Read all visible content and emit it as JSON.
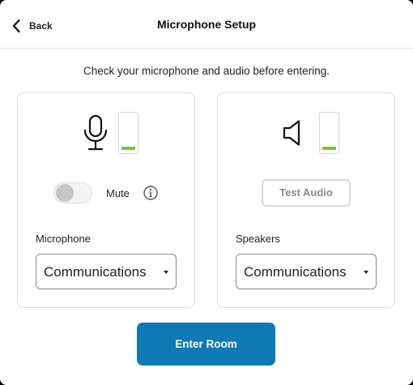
{
  "header": {
    "back_label": "Back",
    "title": "Microphone Setup"
  },
  "subtitle": "Check your microphone and audio before entering.",
  "microphone_panel": {
    "icon": "microphone-icon",
    "level": 0.1,
    "mute": {
      "label": "Mute",
      "enabled": false,
      "info_icon": "info-icon"
    },
    "field_label": "Microphone",
    "selected_device": "Communications"
  },
  "speaker_panel": {
    "icon": "speaker-icon",
    "level": 0.1,
    "test_button_label": "Test Audio",
    "field_label": "Speakers",
    "selected_device": "Communications"
  },
  "enter_button_label": "Enter Room",
  "colors": {
    "accent": "#0d7ab6",
    "level": "#7cc242",
    "toggle_off": "#c6c6c6"
  }
}
